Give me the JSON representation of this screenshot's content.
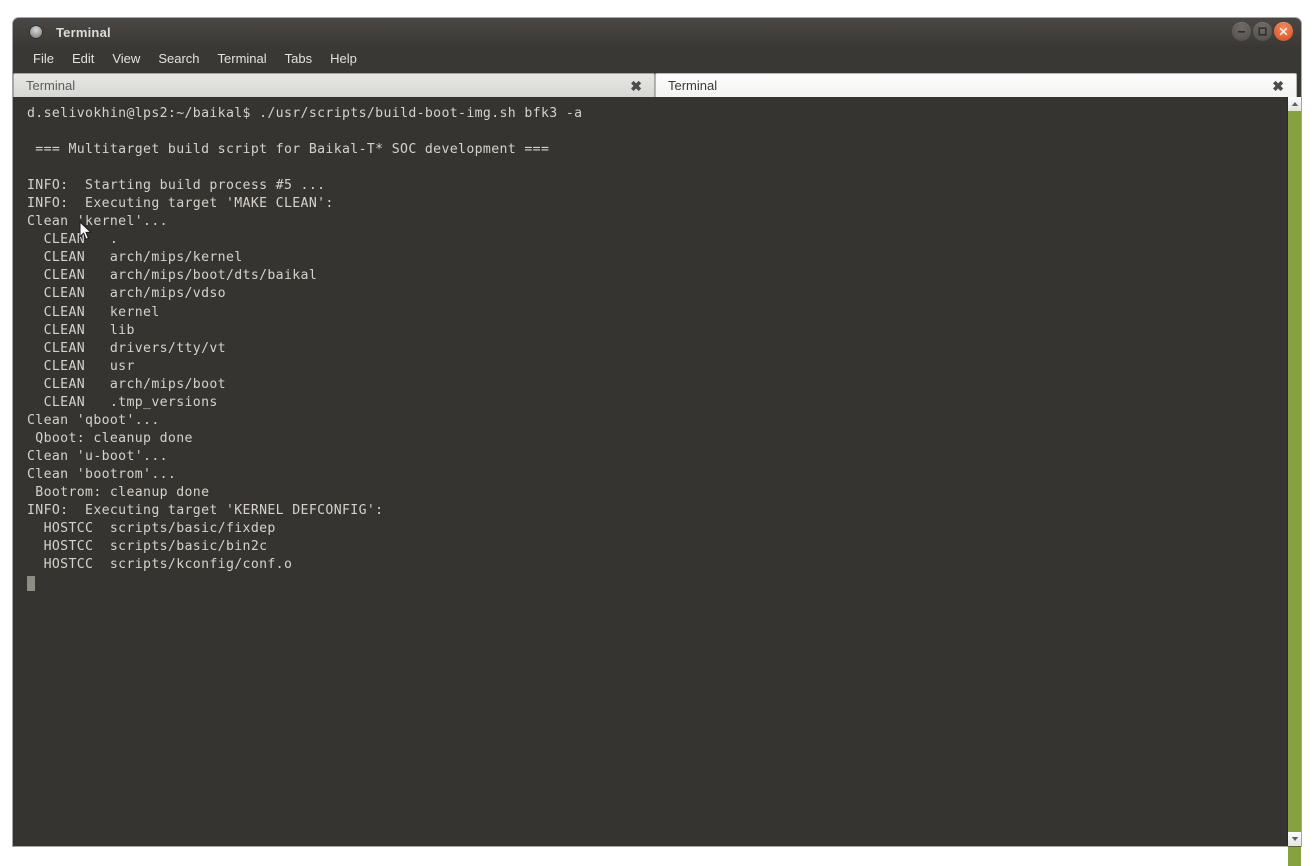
{
  "window": {
    "title": "Terminal",
    "icon": "terminal-circle-icon",
    "controls": [
      {
        "name": "minimize-button",
        "glyph": "minimize-icon"
      },
      {
        "name": "maximize-button",
        "glyph": "maximize-icon"
      },
      {
        "name": "close-button",
        "glyph": "close-icon"
      }
    ]
  },
  "menubar": {
    "items": [
      {
        "label": "File"
      },
      {
        "label": "Edit"
      },
      {
        "label": "View"
      },
      {
        "label": "Search"
      },
      {
        "label": "Terminal"
      },
      {
        "label": "Tabs"
      },
      {
        "label": "Help"
      }
    ]
  },
  "tabs": [
    {
      "label": "Terminal",
      "active": false,
      "close_glyph": "✖"
    },
    {
      "label": "Terminal",
      "active": true,
      "close_glyph": "✖"
    }
  ],
  "terminal": {
    "prompt_user": "d.selivokhin",
    "prompt_host": "lps2",
    "prompt_path": "~/baikal",
    "command": "./usr/scripts/build-boot-img.sh bfk3 -a",
    "foreground": "#d6d2cb",
    "background": "#363430",
    "cursor_color": "#8e8b85",
    "lines": [
      "d.selivokhin@lps2:~/baikal$ ./usr/scripts/build-boot-img.sh bfk3 -a",
      "",
      " === Multitarget build script for Baikal-T* SOC development ===",
      "",
      "INFO:  Starting build process #5 ...",
      "INFO:  Executing target 'MAKE CLEAN':",
      "Clean 'kernel'...",
      "  CLEAN   .",
      "  CLEAN   arch/mips/kernel",
      "  CLEAN   arch/mips/boot/dts/baikal",
      "  CLEAN   arch/mips/vdso",
      "  CLEAN   kernel",
      "  CLEAN   lib",
      "  CLEAN   drivers/tty/vt",
      "  CLEAN   usr",
      "  CLEAN   arch/mips/boot",
      "  CLEAN   .tmp_versions",
      "Clean 'qboot'...",
      " Qboot: cleanup done",
      "Clean 'u-boot'...",
      "Clean 'bootrom'...",
      " Bootrom: cleanup done",
      "INFO:  Executing target 'KERNEL DEFCONFIG':",
      "  HOSTCC  scripts/basic/fixdep",
      "  HOSTCC  scripts/basic/bin2c",
      "  HOSTCC  scripts/kconfig/conf.o"
    ]
  },
  "scrollbar": {
    "up_arrow": "scroll-up-icon",
    "down_arrow": "scroll-down-icon",
    "thumb_color": "#86a140"
  },
  "desktop": {
    "band_color": "#86a140"
  }
}
